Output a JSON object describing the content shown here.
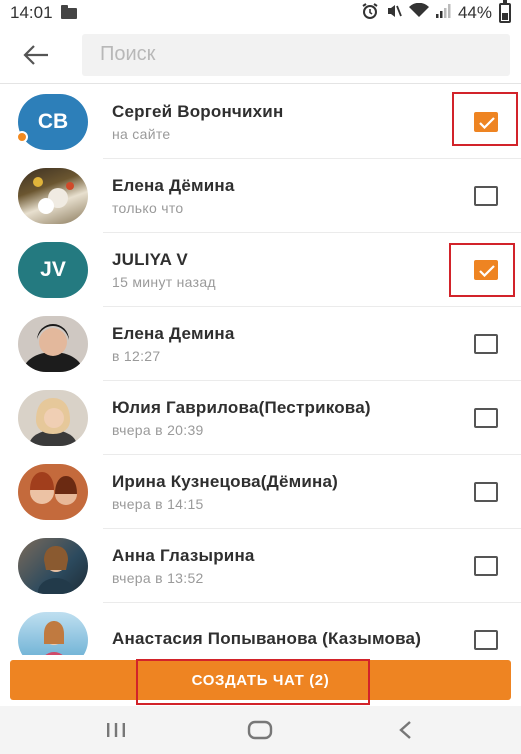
{
  "status_bar": {
    "time": "14:01",
    "battery": "44%"
  },
  "search": {
    "placeholder": "Поиск",
    "value": ""
  },
  "contacts": [
    {
      "name": "Сергей Ворончихин",
      "status": "на сайте",
      "avatar_initials": "СВ",
      "avatar_color": "#2d7fb9",
      "online": true,
      "checked": true
    },
    {
      "name": "Елена Дёмина",
      "status": "только что",
      "avatar_initials": "",
      "checked": false
    },
    {
      "name": "JULIYA V",
      "status": "15 минут назад",
      "avatar_initials": "JV",
      "avatar_color": "#247a80",
      "checked": true
    },
    {
      "name": "Елена Демина",
      "status": "в 12:27",
      "avatar_initials": "",
      "checked": false
    },
    {
      "name": "Юлия Гаврилова(Пестрикова)",
      "status": "вчера в 20:39",
      "avatar_initials": "",
      "checked": false
    },
    {
      "name": "Ирина Кузнецова(Дёмина)",
      "status": "вчера в 14:15",
      "avatar_initials": "",
      "checked": false
    },
    {
      "name": "Анна Глазырина",
      "status": "вчера в 13:52",
      "avatar_initials": "",
      "checked": false
    },
    {
      "name": "Анастасия Попыванова (Казымова)",
      "status": "",
      "avatar_initials": "",
      "checked": false
    }
  ],
  "create_button": {
    "label": "СОЗДАТЬ ЧАТ (2)"
  },
  "colors": {
    "accent": "#ee8422",
    "highlight": "#d2232a"
  },
  "icons": {
    "back": "arrow-left-icon",
    "alarm": "alarm-icon",
    "mute": "mute-icon",
    "wifi": "wifi-icon",
    "signal": "signal-icon",
    "battery": "battery-icon",
    "nav_recents": "recents-icon",
    "nav_home": "home-icon",
    "nav_back": "back-triangle-icon"
  }
}
